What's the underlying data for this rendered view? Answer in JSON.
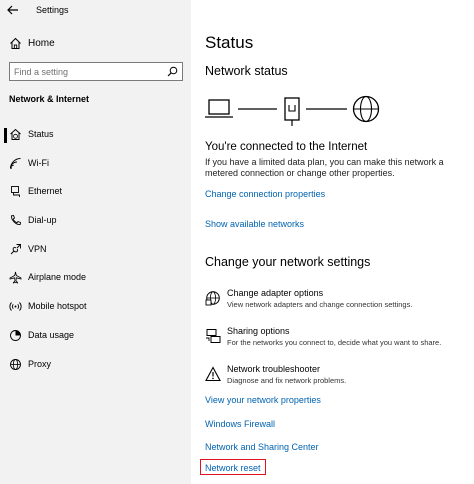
{
  "window": {
    "title": "Settings"
  },
  "sidebar": {
    "home_label": "Home",
    "search_placeholder": "Find a setting",
    "section_label": "Network & Internet",
    "items": [
      {
        "label": "Status",
        "icon": "home-globe-icon",
        "selected": true
      },
      {
        "label": "Wi-Fi",
        "icon": "wifi-icon",
        "selected": false
      },
      {
        "label": "Ethernet",
        "icon": "ethernet-icon",
        "selected": false
      },
      {
        "label": "Dial-up",
        "icon": "phone-icon",
        "selected": false
      },
      {
        "label": "VPN",
        "icon": "vpn-icon",
        "selected": false
      },
      {
        "label": "Airplane mode",
        "icon": "airplane-icon",
        "selected": false
      },
      {
        "label": "Mobile hotspot",
        "icon": "hotspot-icon",
        "selected": false
      },
      {
        "label": "Data usage",
        "icon": "data-usage-icon",
        "selected": false
      },
      {
        "label": "Proxy",
        "icon": "globe-icon",
        "selected": false
      }
    ]
  },
  "main": {
    "title": "Status",
    "network_status_heading": "Network status",
    "connected_heading": "You're connected to the Internet",
    "connected_desc": "If you have a limited data plan, you can make this network a metered connection or change other properties.",
    "change_connection_link": "Change connection properties",
    "show_networks_link": "Show available networks",
    "change_settings_heading": "Change your network settings",
    "settings": [
      {
        "title": "Change adapter options",
        "desc": "View network adapters and change connection settings.",
        "icon": "adapter-icon"
      },
      {
        "title": "Sharing options",
        "desc": "For the networks you connect to, decide what you want to share.",
        "icon": "sharing-icon"
      },
      {
        "title": "Network troubleshooter",
        "desc": "Diagnose and fix network problems.",
        "icon": "warning-icon"
      }
    ],
    "links": [
      "View your network properties",
      "Windows Firewall",
      "Network and Sharing Center",
      "Network reset"
    ]
  },
  "colors": {
    "link": "#0063b1",
    "highlight": "#e2131e",
    "sidebar_bg": "#f2f2f2"
  }
}
